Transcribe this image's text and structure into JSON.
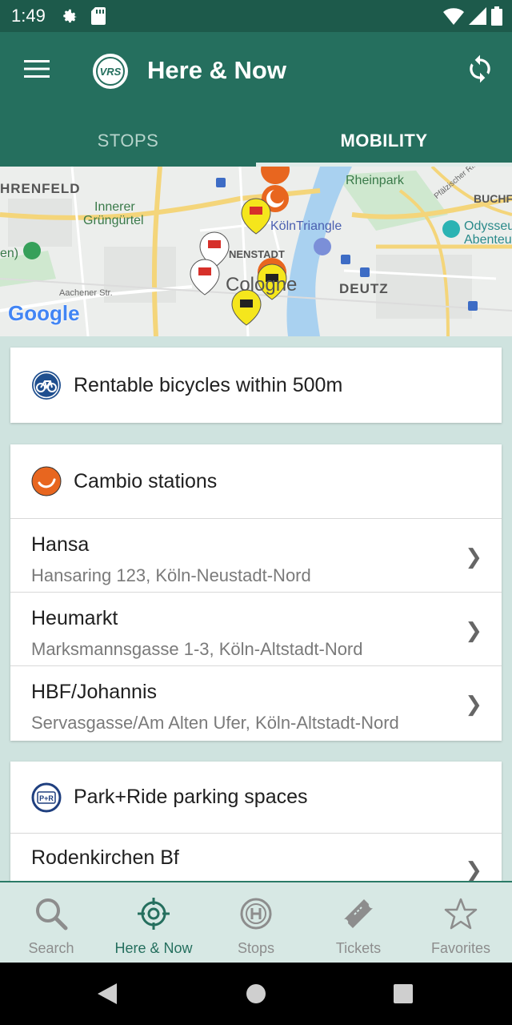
{
  "status_bar": {
    "time": "1:49"
  },
  "app_bar": {
    "logo_text": "VRS",
    "title": "Here & Now",
    "tabs": [
      {
        "label": "STOPS",
        "active": false
      },
      {
        "label": "MOBILITY",
        "active": true
      }
    ]
  },
  "map": {
    "labels": {
      "ehrenfeld": "HRENFELD",
      "innerer": "Innerer",
      "gruenguertel": "Grüngürtel",
      "rheinpark": "Rheinpark",
      "buchf": "BUCHF",
      "koelntriangle": "KölnTriangle",
      "odysseum": "Odysseu",
      "abenteu": "Abenteu",
      "nenstadt": "NENSTADT",
      "cologne": "Cologne",
      "deutz": "DEUTZ",
      "aachener": "Aachener Str.",
      "en": "en)",
      "pfaelzischer": "Pfälzischer Ring"
    },
    "google_logo": "Google"
  },
  "bicycles_card": {
    "title": "Rentable bicycles within 500m",
    "icon": "bicycle-icon"
  },
  "cambio_card": {
    "title": "Cambio stations",
    "icon": "cambio-icon",
    "stations": [
      {
        "name": "Hansa",
        "address": "Hansaring 123, Köln-Neustadt-Nord"
      },
      {
        "name": "Heumarkt",
        "address": "Marksmannsgasse 1-3, Köln-Altstadt-Nord"
      },
      {
        "name": "HBF/Johannis",
        "address": "Servasgasse/Am Alten Ufer, Köln-Altstadt-Nord"
      }
    ]
  },
  "park_ride_card": {
    "title": "Park+Ride parking spaces",
    "icon": "park-ride-icon",
    "badge": "P+R",
    "spaces": [
      {
        "name": "Rodenkirchen Bf"
      }
    ]
  },
  "chevron": "❯",
  "bottom_nav": [
    {
      "label": "Search",
      "icon": "search-icon",
      "active": false
    },
    {
      "label": "Here & Now",
      "icon": "target-icon",
      "active": true
    },
    {
      "label": "Stops",
      "icon": "stop-h-icon",
      "active": false
    },
    {
      "label": "Tickets",
      "icon": "ticket-icon",
      "active": false
    },
    {
      "label": "Favorites",
      "icon": "star-icon",
      "active": false
    }
  ],
  "colors": {
    "primary": "#256f5e",
    "status_bar": "#1d5a4b",
    "background": "#cfe3df",
    "cambio_orange": "#e8661f",
    "bike_blue": "#1f4f8f",
    "taxi_yellow": "#f5e61c"
  }
}
